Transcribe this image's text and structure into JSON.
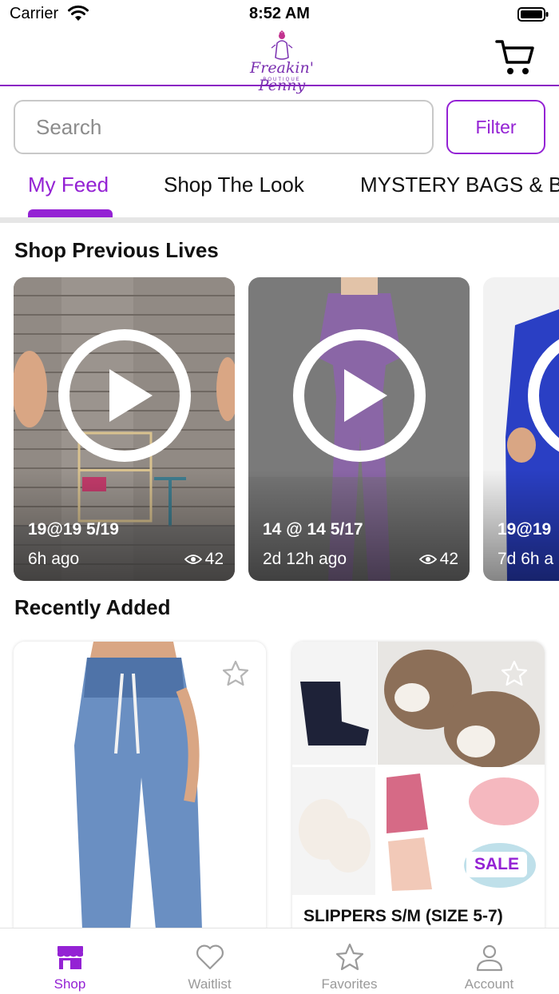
{
  "status_bar": {
    "carrier": "Carrier",
    "time": "8:52 AM"
  },
  "header": {
    "logo_text": "Freakin' Penny",
    "logo_subtext": "BOUTIQUE"
  },
  "search": {
    "placeholder": "Search",
    "filter_label": "Filter"
  },
  "tabs": [
    {
      "label": "My Feed",
      "active": true
    },
    {
      "label": "Shop The Look",
      "active": false
    },
    {
      "label": "MYSTERY BAGS & B",
      "active": false
    }
  ],
  "previous_lives": {
    "title": "Shop Previous Lives",
    "items": [
      {
        "title": "19@19 5/19",
        "time": "6h ago",
        "views": "42"
      },
      {
        "title": "14 @ 14 5/17",
        "time": "2d 12h ago",
        "views": "42"
      },
      {
        "title": "19@19",
        "time": "7d 6h a",
        "views": ""
      }
    ]
  },
  "recently_added": {
    "title": "Recently Added",
    "items": [
      {
        "title": "",
        "badge": ""
      },
      {
        "title": "SLIPPERS S/M (SIZE 5-7)",
        "badge": "SALE"
      }
    ]
  },
  "bottom_nav": [
    {
      "label": "Shop",
      "icon": "shop-icon",
      "active": true
    },
    {
      "label": "Waitlist",
      "icon": "heart-icon",
      "active": false
    },
    {
      "label": "Favorites",
      "icon": "star-icon",
      "active": false
    },
    {
      "label": "Account",
      "icon": "person-icon",
      "active": false
    }
  ],
  "colors": {
    "accent": "#9422d4",
    "inactive": "#9a9a9a"
  }
}
